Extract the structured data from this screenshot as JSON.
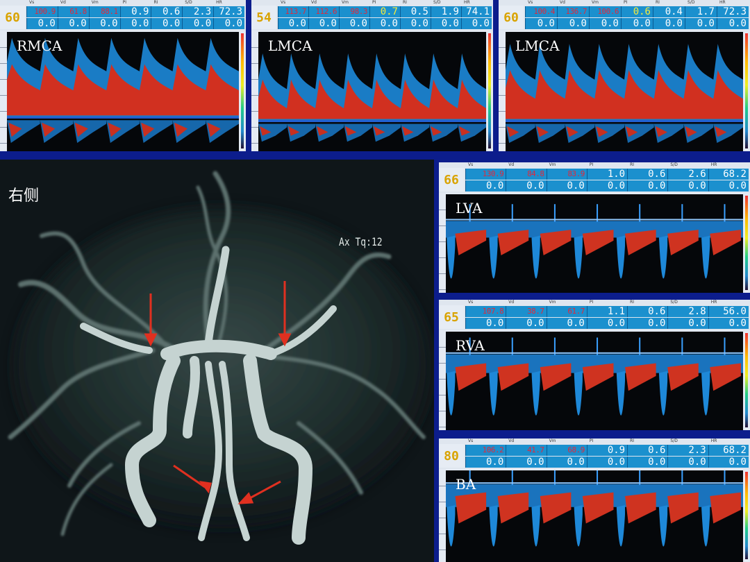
{
  "header_columns": [
    "Vs",
    "Vd",
    "Vm",
    "PI",
    "RI",
    "S/D",
    "HR"
  ],
  "panels": [
    {
      "id": "rmca",
      "label": "RMCA",
      "depth": "60",
      "row1": [
        "100.9",
        "61.8",
        "88.1",
        "0.9",
        "0.6",
        "2.3",
        "72.3"
      ],
      "row2": [
        "0.0",
        "0.0",
        "0.0",
        "0.0",
        "0.0",
        "0.0",
        "0.0"
      ]
    },
    {
      "id": "lmca1",
      "label": "LMCA",
      "depth": "54",
      "row1": [
        "113.7",
        "112.6",
        "98.3",
        "0.7",
        "0.5",
        "1.9",
        "74.1"
      ],
      "row2": [
        "0.0",
        "0.0",
        "0.0",
        "0.0",
        "0.0",
        "0.0",
        "0.0"
      ]
    },
    {
      "id": "lmca2",
      "label": "LMCA",
      "depth": "60",
      "row1": [
        "100.4",
        "136.7",
        "100.6",
        "0.6",
        "0.4",
        "1.7",
        "72.3"
      ],
      "row2": [
        "0.0",
        "0.0",
        "0.0",
        "0.0",
        "0.0",
        "0.0",
        "0.0"
      ]
    },
    {
      "id": "lva",
      "label": "LVA",
      "depth": "66",
      "row1": [
        "130.9",
        "84.8",
        "83.9",
        "1.0",
        "0.6",
        "2.6",
        "68.2"
      ],
      "row2": [
        "0.0",
        "0.0",
        "0.0",
        "0.0",
        "0.0",
        "0.0",
        "0.0"
      ]
    },
    {
      "id": "rva",
      "label": "RVA",
      "depth": "65",
      "row1": [
        "107.8",
        "38.7",
        "61.7",
        "1.1",
        "0.6",
        "2.8",
        "56.0"
      ],
      "row2": [
        "0.0",
        "0.0",
        "0.0",
        "0.0",
        "0.0",
        "0.0",
        "0.0"
      ]
    },
    {
      "id": "ba",
      "label": "BA",
      "depth": "80",
      "row1": [
        "106.2",
        "41.7",
        "68.9",
        "0.9",
        "0.6",
        "2.3",
        "68.2"
      ],
      "row2": [
        "0.0",
        "0.0",
        "0.0",
        "0.0",
        "0.0",
        "0.0",
        "0.0"
      ]
    }
  ],
  "angio": {
    "side_label": "右侧",
    "scan_label": "Ax Tq:12"
  },
  "colors": {
    "background": "#0c1d8c",
    "cell": "#1b90ce",
    "red_value": "#e2283a",
    "yellow_value": "#f6ec3a",
    "depth": "#d9a300",
    "arrow": "#e03020"
  }
}
